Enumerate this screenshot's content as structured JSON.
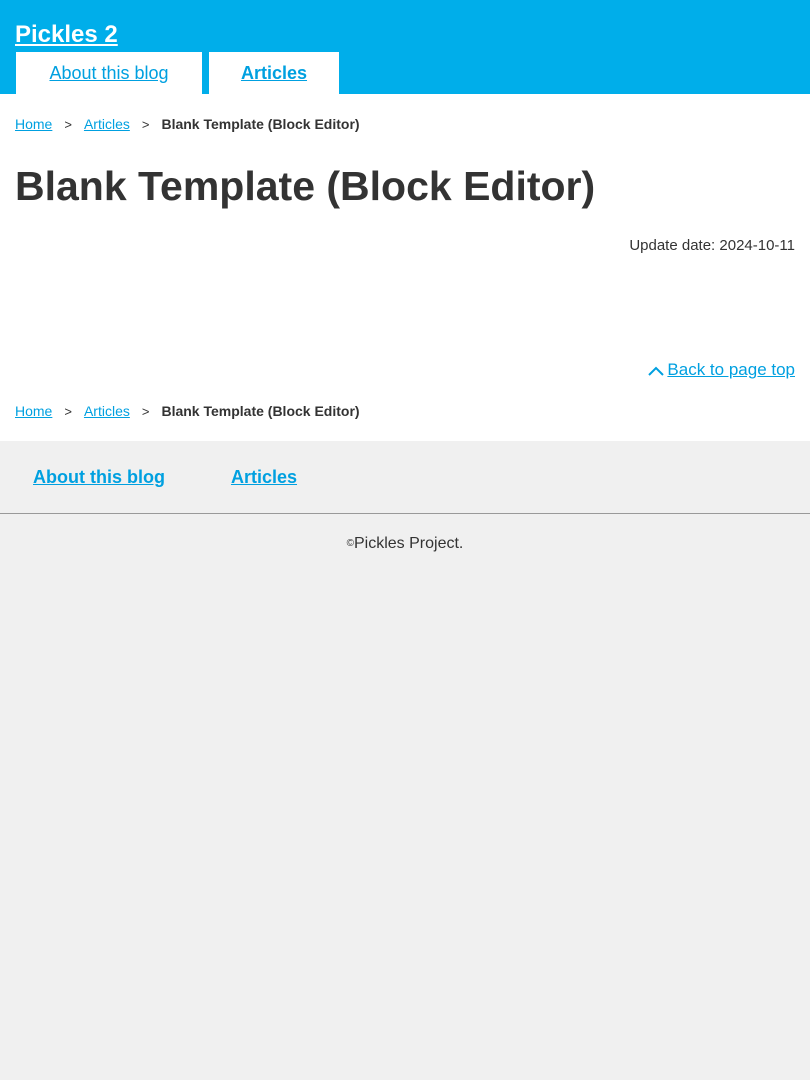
{
  "header": {
    "site_title": "Pickles 2",
    "nav": [
      {
        "label": "About this blog"
      },
      {
        "label": "Articles"
      }
    ]
  },
  "breadcrumb": {
    "home": "Home",
    "articles": "Articles",
    "separator": ">",
    "current": "Blank Template (Block Editor)"
  },
  "main": {
    "title": "Blank Template (Block Editor)",
    "update_date": "Update date: 2024-10-11",
    "back_to_top": "Back to page top",
    "back_to_top_icon": "chevron-up-icon"
  },
  "footer": {
    "nav": [
      {
        "label": "About this blog"
      },
      {
        "label": "Articles"
      }
    ],
    "copyright_mark": "©",
    "copyright_text": "Pickles Project."
  },
  "colors": {
    "header_bg": "#00aeea",
    "link": "#00a0e0",
    "footer_bg": "#f0f0f0"
  }
}
